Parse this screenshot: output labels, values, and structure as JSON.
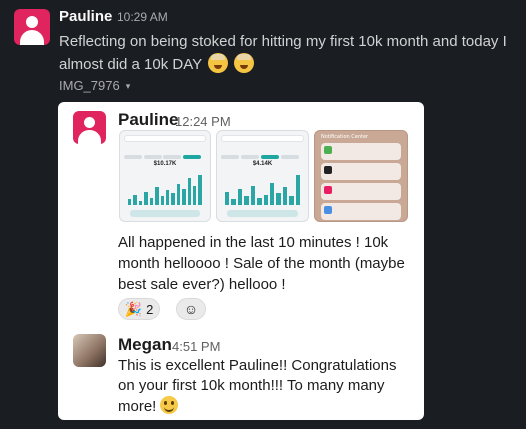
{
  "message": {
    "author": "Pauline",
    "time": "10:29 AM",
    "text": "Reflecting on being stoked for hitting my first 10k month and today I almost did a 10k DAY",
    "emojis": [
      "exploding-head-emoji",
      "exploding-head-emoji"
    ]
  },
  "attachment": {
    "filename": "IMG_7976",
    "caret": "▾"
  },
  "shared": {
    "author": "Pauline",
    "time": "12:24 PM",
    "text": "All happened in the last 10 minutes ! 10k month helloooo ! Sale of the month (maybe best sale ever?) hellooo !",
    "thumbnails": {
      "t1_value": "$10.17K",
      "t2_value": "$4.14K",
      "t3_title": "Notification Center"
    },
    "reaction": {
      "emoji": "🎉",
      "count": "2"
    },
    "add_reaction_icon": "☺"
  },
  "reply": {
    "author": "Megan",
    "time": "4:51 PM",
    "text": "This is excellent Pauline!! Congratulations on your first 10k month!!! To many many more!"
  },
  "colors": {
    "background": "#1a1d21",
    "avatar": "#e0245e",
    "accent": "#2ba6a5"
  }
}
